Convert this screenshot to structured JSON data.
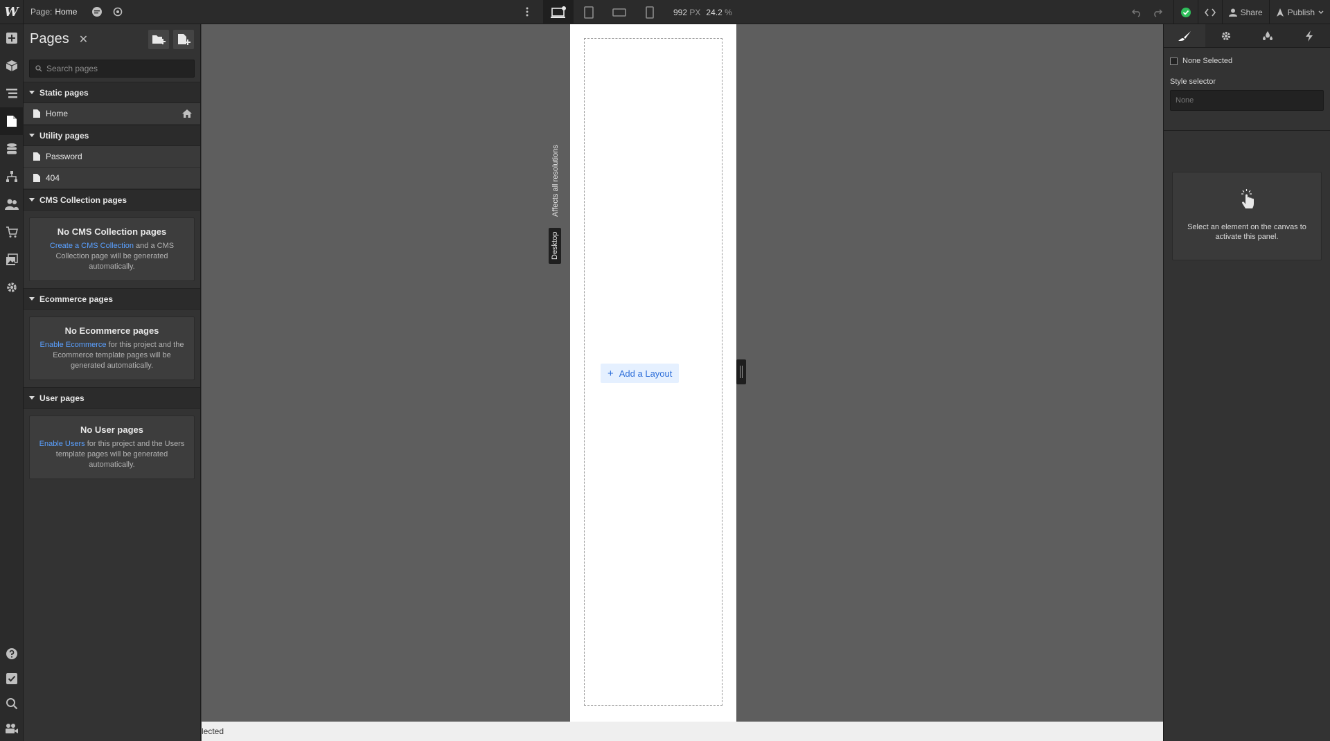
{
  "topbar": {
    "page_label": "Page:",
    "page_name": "Home",
    "width_value": "992",
    "width_unit": "PX",
    "zoom_value": "24.2",
    "zoom_unit": "%",
    "share_label": "Share",
    "publish_label": "Publish"
  },
  "pages_panel": {
    "title": "Pages",
    "search_placeholder": "Search pages",
    "sections": {
      "static": {
        "title": "Static pages",
        "pages": [
          "Home"
        ]
      },
      "utility": {
        "title": "Utility pages",
        "pages": [
          "Password",
          "404"
        ]
      },
      "cms": {
        "title": "CMS Collection pages",
        "empty_title": "No CMS Collection pages",
        "link": "Create a CMS Collection",
        "text": " and a CMS Collection page will be generated automatically."
      },
      "ecommerce": {
        "title": "Ecommerce pages",
        "empty_title": "No Ecommerce pages",
        "link": "Enable Ecommerce",
        "text": " for this project and the Ecommerce template pages will be generated automatically."
      },
      "user": {
        "title": "User pages",
        "empty_title": "No User pages",
        "link": "Enable Users",
        "text": " for this project and the Users template pages will be generated automatically."
      }
    }
  },
  "canvas": {
    "add_layout_label": "Add a Layout",
    "breakpoint_label": "Desktop",
    "affects_label": "Affects all resolutions"
  },
  "statusbar": {
    "text": "lected"
  },
  "right_panel": {
    "none_selected": "None Selected",
    "style_selector_label": "Style selector",
    "style_selector_value": "None",
    "activate_text": "Select an element on the canvas to activate this panel."
  },
  "colors": {
    "accent": "#5aa0ff",
    "status_ok": "#2fbf5b",
    "canvas_bg": "#5e5e5e"
  }
}
